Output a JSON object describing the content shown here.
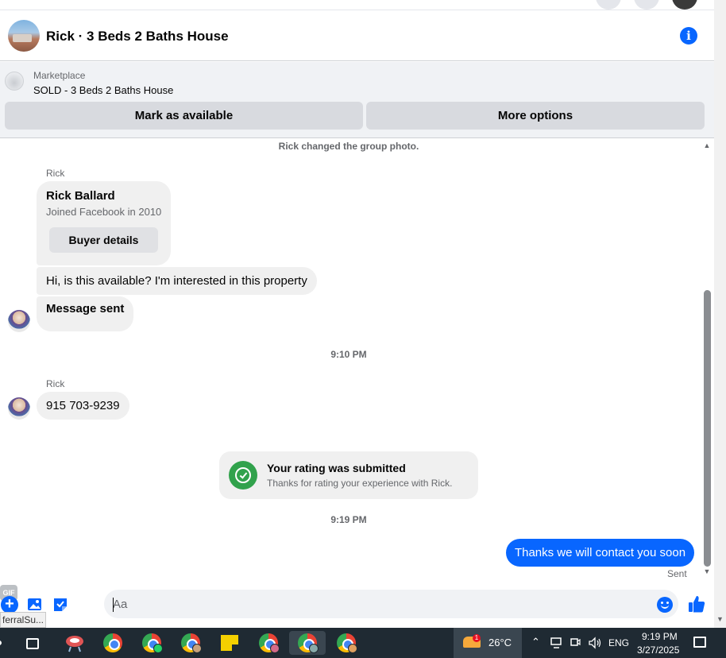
{
  "header": {
    "title": "Rick · 3 Beds 2 Baths House",
    "info_icon": "info-icon"
  },
  "marketplace": {
    "label": "Marketplace",
    "item": "SOLD - 3 Beds 2 Baths House",
    "mark_available_label": "Mark as available",
    "more_options_label": "More options"
  },
  "chat": {
    "system_photo_change": "Rick changed the group photo.",
    "sender_name": "Rick",
    "card": {
      "name": "Rick Ballard",
      "subtitle": "Joined Facebook in 2010",
      "button_label": "Buyer details"
    },
    "messages": [
      {
        "from": "Rick",
        "text": "Hi, is this available? I'm interested in this property"
      },
      {
        "from": "Rick",
        "text": "Message sent"
      }
    ],
    "timestamp_1": "9:10 PM",
    "sender_name_2": "Rick",
    "phone_message": "915 703-9239",
    "rating": {
      "title": "Your rating was submitted",
      "subtitle": "Thanks for rating your experience with Rick."
    },
    "timestamp_2": "9:19 PM",
    "outgoing_message": "Thanks we will contact you soon",
    "sent_status": "Sent"
  },
  "composer": {
    "placeholder": "Aa",
    "gif_label": "GIF",
    "tooltip": "ferralSu..."
  },
  "taskbar": {
    "temperature": "26°C",
    "weather_badge": "1",
    "language": "ENG",
    "time": "9:19 PM",
    "date": "3/27/2025"
  },
  "colors": {
    "accent": "#0866ff",
    "bubble_in": "#f0f0f0",
    "success": "#31a24c",
    "taskbar": "#1f2a33"
  }
}
